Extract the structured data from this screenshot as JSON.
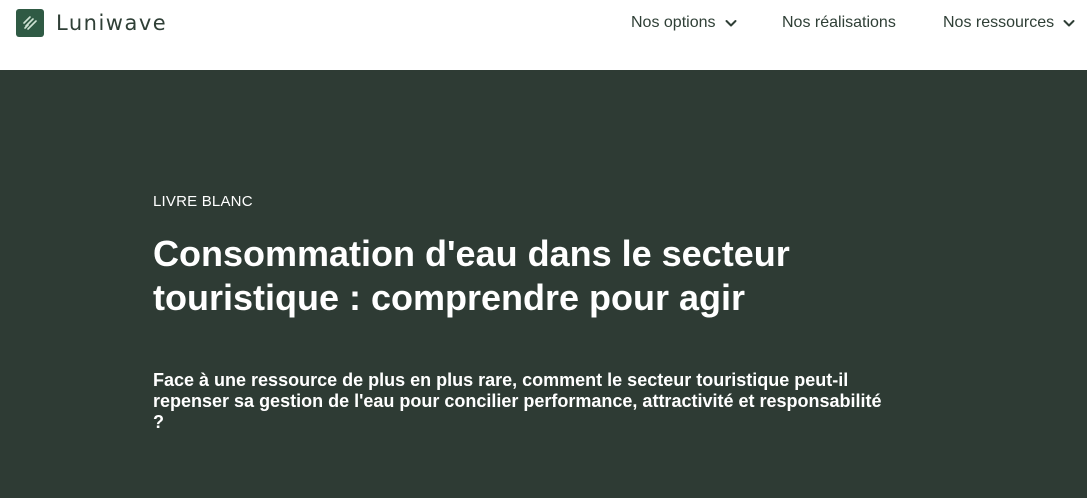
{
  "header": {
    "brand": "Luniwave",
    "logo_icon": "luniwave-logo-icon",
    "nav": [
      {
        "label": "Nos options",
        "has_dropdown": true
      },
      {
        "label": "Nos réalisations",
        "has_dropdown": false
      },
      {
        "label": "Nos ressources",
        "has_dropdown": true
      }
    ]
  },
  "hero": {
    "eyebrow": "LIVRE BLANC",
    "title": "Consommation d'eau dans le secteur touristique : comprendre pour agir",
    "lede": "Face à une ressource de plus en plus rare, comment le secteur touristique peut-il repenser sa gestion de l'eau pour concilier performance, attractivité et responsabilité ?"
  },
  "colors": {
    "brand": "#2f5a44",
    "hero_background": "#2e3b34",
    "nav_text": "#2f3f36",
    "hero_text": "#ffffff"
  }
}
